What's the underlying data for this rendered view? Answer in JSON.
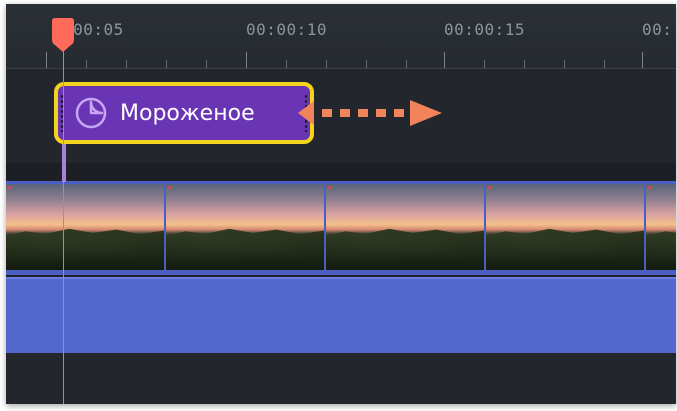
{
  "timeline": {
    "ruler_labels": [
      ":00:05",
      "00:00:10",
      "00:00:15",
      "00:"
    ],
    "playhead_time_label_visible": false
  },
  "sticker_clip": {
    "label": "Мороженое",
    "icon": "sticker-icon",
    "selected": true
  },
  "colors": {
    "background": "#1f2229",
    "ruler_text": "#8e939c",
    "playhead": "#ff6a5a",
    "sticker_fill": "#6a35b5",
    "sticker_border": "#f3d31c",
    "drag_arrow": "#f2845c",
    "video_track": "#4a5ec4",
    "audio_track": "#5367cc"
  }
}
